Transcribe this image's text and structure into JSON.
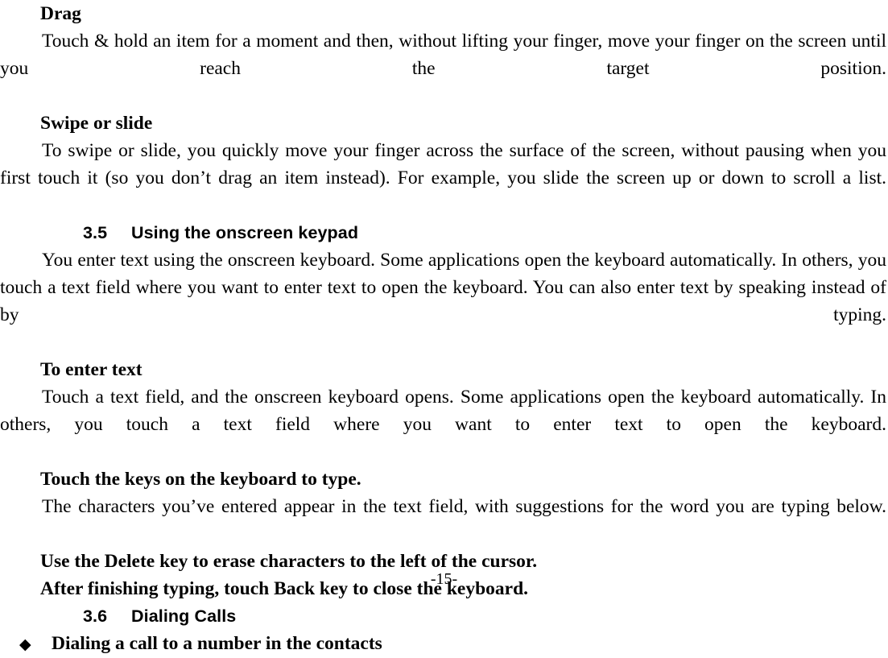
{
  "document": {
    "page_number_label": "-15-",
    "bullet_glyph": "◆"
  },
  "blocks": {
    "drag_heading": "Drag",
    "drag_body": "Touch & hold an item for a moment and then, without lifting your finger, move your finger on the screen until you reach the target position.",
    "swipe_heading": "Swipe or slide",
    "swipe_body": "To swipe or slide, you quickly move your finger across the surface of the screen, without pausing when you first touch it (so you don’t drag an item instead). For example, you slide the screen up or down to scroll a list.",
    "section_3_5_number": "3.5",
    "section_3_5_title": "Using the onscreen keypad",
    "keypad_intro": "You enter text using the onscreen keyboard. Some applications open the keyboard automatically. In others, you touch a text field where you want to enter text to open the keyboard. You can also enter text by speaking instead of by typing.",
    "enter_text_heading": "To enter text",
    "enter_text_body": "Touch a text field, and the onscreen keyboard opens. Some applications open the keyboard automatically. In others, you touch a text field where you want to enter text to open the keyboard.",
    "touch_keys_heading": "Touch the keys on the keyboard to type.",
    "touch_keys_body": "The characters you’ve entered appear in the text field, with suggestions for the word you are typing below.",
    "delete_key_line": "Use the Delete key to erase characters to the left of the cursor.",
    "back_key_line": "After finishing typing, touch Back key to close the keyboard.",
    "section_3_6_number": "3.6",
    "section_3_6_title": "Dialing Calls",
    "dialing_bullet": "Dialing a call to a number in the contacts"
  }
}
